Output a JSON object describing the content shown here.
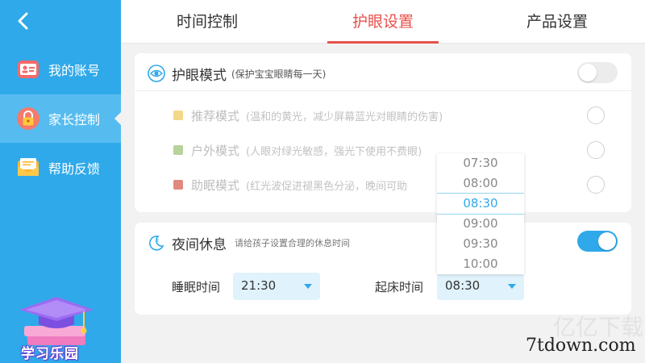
{
  "sidebar": {
    "items": [
      {
        "label": "我的账号",
        "icon": "account-card-icon"
      },
      {
        "label": "家长控制",
        "icon": "lock-icon"
      },
      {
        "label": "帮助反馈",
        "icon": "mail-icon"
      }
    ],
    "mascot_label": "学习乐园"
  },
  "tabs": [
    {
      "label": "时间控制"
    },
    {
      "label": "护眼设置"
    },
    {
      "label": "产品设置"
    }
  ],
  "eye_protection": {
    "title": "护眼模式",
    "subtitle": "(保护宝宝眼睛每一天)",
    "enabled": false,
    "modes": [
      {
        "name": "推荐模式",
        "desc": "(温和的黄光，减少屏幕蓝光对眼睛的伤害)",
        "color": "#f4d88a"
      },
      {
        "name": "户外模式",
        "desc": "(人眼对绿光敏感，强光下使用不费眼)",
        "color": "#b6d39a"
      },
      {
        "name": "助眠模式",
        "desc": "(红光波促进褪黑色分泌，晚间可助",
        "color": "#e0897c"
      }
    ]
  },
  "night_rest": {
    "title": "夜间休息",
    "subtitle": "请给孩子设置合理的休息时间",
    "enabled": true,
    "sleep_label": "睡眠时间",
    "sleep_value": "21:30",
    "wake_label": "起床时间",
    "wake_value": "08:30"
  },
  "time_picker": {
    "options": [
      "07:30",
      "08:00",
      "08:30",
      "09:00",
      "09:30",
      "10:00"
    ],
    "selected": "08:30"
  },
  "watermark": {
    "faint": "亿亿下载",
    "url": "7tdown.com"
  },
  "colors": {
    "accent": "#2fa9e9",
    "tab_active": "#e8514b"
  }
}
